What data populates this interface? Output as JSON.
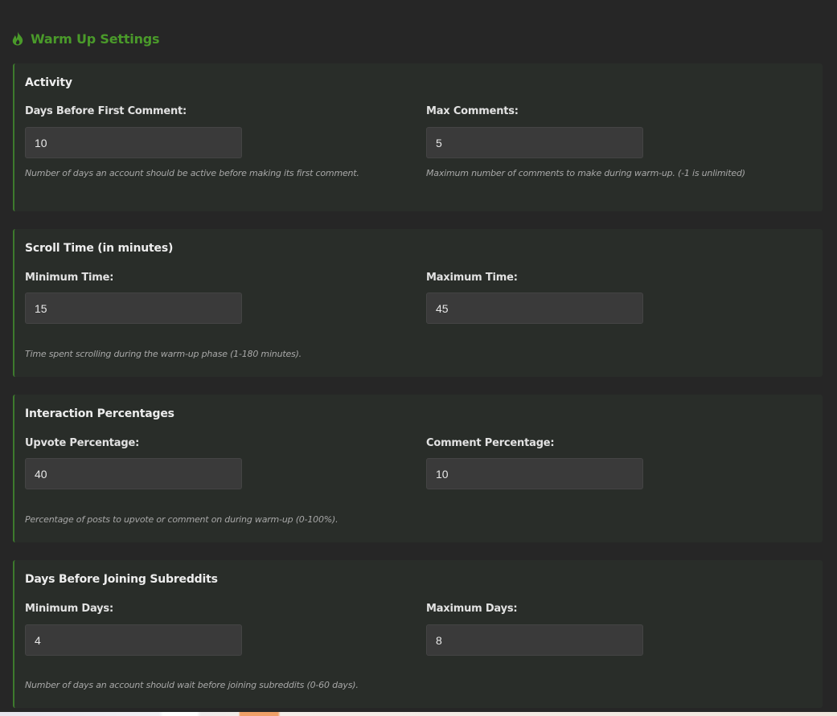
{
  "page": {
    "title": "Warm Up Settings",
    "title_icon": "flame-icon",
    "accent_color": "#4a9a2a"
  },
  "sections": [
    {
      "heading": "Activity",
      "left": {
        "label": "Days Before First Comment:",
        "value": "10"
      },
      "right": {
        "label": "Max Comments:",
        "value": "5"
      },
      "left_hint": "Number of days an account should be active before making its first comment.",
      "right_hint": "Maximum number of comments to make during warm-up. (-1 is unlimited)"
    },
    {
      "heading": "Scroll Time (in minutes)",
      "left": {
        "label": "Minimum Time:",
        "value": "15"
      },
      "right": {
        "label": "Maximum Time:",
        "value": "45"
      },
      "hint": "Time spent scrolling during the warm-up phase (1-180 minutes)."
    },
    {
      "heading": "Interaction Percentages",
      "left": {
        "label": "Upvote Percentage:",
        "value": "40"
      },
      "right": {
        "label": "Comment Percentage:",
        "value": "10"
      },
      "hint": "Percentage of posts to upvote or comment on during warm-up (0-100%)."
    },
    {
      "heading": "Days Before Joining Subreddits",
      "left": {
        "label": "Minimum Days:",
        "value": "4"
      },
      "right": {
        "label": "Maximum Days:",
        "value": "8"
      },
      "hint": "Number of days an account should wait before joining subreddits (0-60 days)."
    }
  ]
}
